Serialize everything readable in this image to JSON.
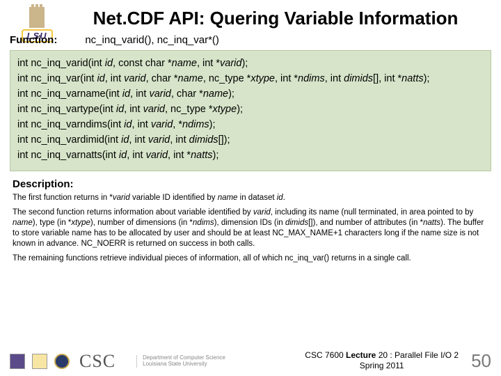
{
  "header": {
    "lsu_text": "LSU",
    "title": "Net.CDF API: Quering Variable Information",
    "function_label": "Function:",
    "function_names": "nc_inq_varid(), nc_inq_var*()"
  },
  "code_lines": [
    "int nc_inq_varid(int <i>id</i>, const char *<i>name</i>, int *<i>varid</i>);",
    "int nc_inq_var(int <i>id</i>, int <i>varid</i>, char *<i>name</i>, nc_type *<i>xtype</i>, int *<i>ndims</i>, int <i>dimids</i>[], int *<i>natts</i>);",
    "int nc_inq_varname(int <i>id</i>, int <i>varid</i>, char *<i>name</i>);",
    "int nc_inq_vartype(int <i>id</i>, int <i>varid</i>, nc_type *<i>xtype</i>);",
    "int nc_inq_varndims(int <i>id</i>, int <i>varid</i>, *<i>ndims</i>);",
    "int nc_inq_vardimid(int <i>id</i>, int  <i>varid</i>, int <i>dimids</i>[]);",
    "int nc_inq_varnatts(int <i>id</i>, int <i>varid</i>, int *<i>natts</i>);"
  ],
  "description": {
    "label": "Description:",
    "paragraphs": [
      "The first function returns in *<i>varid</i> variable ID identified by <i>name</i> in dataset <i>id</i>.",
      "The second function returns information about variable identified by <i>varid</i>, including its name (null terminated, in area pointed to by <i>name</i>), type (in *<i>xtype</i>), number of dimensions (in *<i>ndims</i>), dimension IDs (in <i>dimids</i>[]), and number of attributes (in *<i>natts</i>). The buffer to store variable name has to be allocated by user and should be at least NC_MAX_NAME+1 characters long if the name size is not known in advance. NC_NOERR is returned on success in both calls.",
      "The remaining functions retrieve individual pieces of information, all of which nc_inq_var() returns in a single call."
    ]
  },
  "footer": {
    "csc": "CSC",
    "dept_line1": "Department of Computer Science",
    "dept_line2": "Louisiana State University",
    "lecture_html": "CSC 7600 <b>Lecture</b> 20 : Parallel File I/O 2<br>Spring 2011",
    "page": "50"
  }
}
